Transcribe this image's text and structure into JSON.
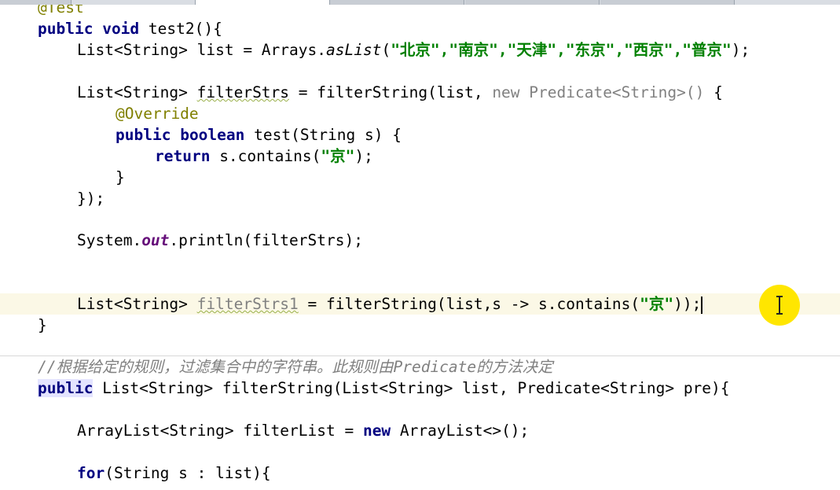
{
  "editor": {
    "line_annotation": "@Test",
    "test_method": {
      "kw_public": "public",
      "kw_void": "void",
      "signature": " test2(){",
      "list_decl_a": "List<String> list = Arrays.",
      "list_decl_method": "asList",
      "list_decl_b": "(",
      "str_cities": "\"北京\",\"南京\",\"天津\",\"东京\",\"西京\",\"普京\"",
      "list_decl_c": ");",
      "filter_decl_a": "List<String> ",
      "filter_var": "filterStrs",
      "filter_decl_b": " = filterString(list, ",
      "filter_decl_anon": "new Predicate<String>()",
      "filter_decl_c": " {",
      "override": "@Override",
      "test_sig_kw1": "public",
      "test_sig_kw2": "boolean",
      "test_sig_rest": " test(String s) {",
      "return_kw": "return",
      "return_a": " s.contains(",
      "return_str": "\"京\"",
      "return_b": ");",
      "close_brace": "}",
      "close_anon": "});",
      "print_a": "System.",
      "print_out": "out",
      "print_b": ".println(filterStrs);",
      "lambda_a": "List<String> ",
      "lambda_var": "filterStrs1",
      "lambda_b": " = filterString(list,s -> s.contains(",
      "lambda_str": "\"京\"",
      "lambda_c": "));",
      "end_brace": "}"
    },
    "filter_method": {
      "comment": "//根据给定的规则，过滤集合中的字符串。此规则由Predicate的方法决定",
      "kw_public": "public",
      "signature": " List<String> filterString(List<String> list, Predicate<String> pre){",
      "arraylist_a": "ArrayList<String> filterList = ",
      "kw_new": "new",
      "arraylist_b": " ArrayList<>();",
      "kw_for": "for",
      "for_rest": "(String s : list){"
    }
  }
}
